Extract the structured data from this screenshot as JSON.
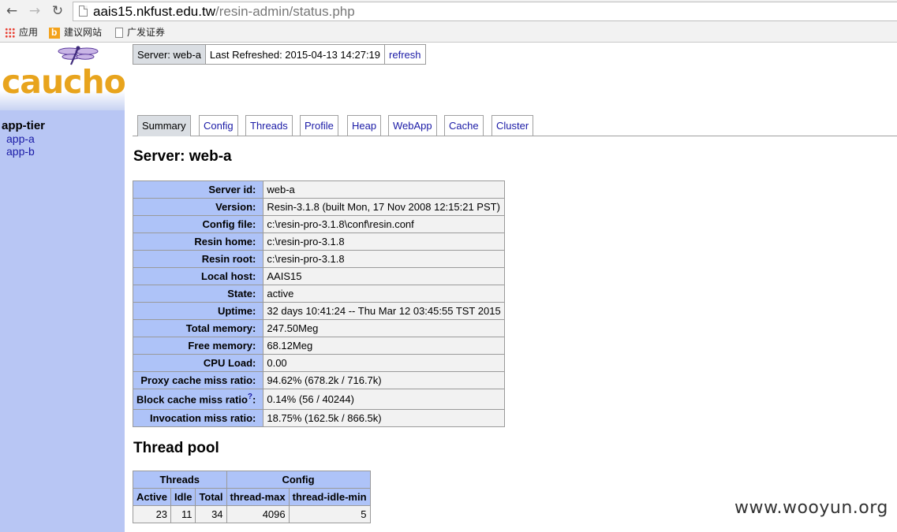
{
  "browser": {
    "url_host": "aais15.nkfust.edu.tw",
    "url_path": "/resin-admin/status.php",
    "bookmarks": [
      {
        "label": "应用",
        "icon": "apps-grid-icon"
      },
      {
        "label": "建议网站",
        "icon": "bing-icon"
      },
      {
        "label": "广发证券",
        "icon": "page-icon"
      }
    ]
  },
  "sidebar": {
    "logo": "caucho",
    "tier": "app-tier",
    "links": [
      "app-a",
      "app-b"
    ]
  },
  "header": {
    "server": "Server: web-a",
    "last_refreshed": "Last Refreshed: 2015-04-13 14:27:19",
    "refresh": "refresh"
  },
  "tabs": [
    "Summary",
    "Config",
    "Threads",
    "Profile",
    "Heap",
    "WebApp",
    "Cache",
    "Cluster"
  ],
  "active_tab": "Summary",
  "main": {
    "server_heading": "Server: web-a",
    "thread_heading": "Thread pool"
  },
  "summary": [
    {
      "label": "Server id:",
      "value": "web-a"
    },
    {
      "label": "Version:",
      "value": "Resin-3.1.8 (built Mon, 17 Nov 2008 12:15:21 PST)"
    },
    {
      "label": "Config file:",
      "value": "c:\\resin-pro-3.1.8\\conf\\resin.conf"
    },
    {
      "label": "Resin home:",
      "value": "c:\\resin-pro-3.1.8"
    },
    {
      "label": "Resin root:",
      "value": "c:\\resin-pro-3.1.8"
    },
    {
      "label": "Local host:",
      "value": "AAIS15"
    },
    {
      "label": "State:",
      "value": "active"
    },
    {
      "label": "Uptime:",
      "value": "32 days 10:41:24 -- Thu Mar 12 03:45:55 TST 2015"
    },
    {
      "label": "Total memory:",
      "value": "247.50Meg"
    },
    {
      "label": "Free memory:",
      "value": "68.12Meg"
    },
    {
      "label": "CPU Load:",
      "value": "0.00"
    },
    {
      "label": "Proxy cache miss ratio:",
      "value": "94.62% (678.2k / 716.7k)"
    },
    {
      "label": "Block cache miss ratio",
      "help": "?",
      "suffix": ":",
      "value": "0.14% (56 / 40244)"
    },
    {
      "label": "Invocation miss ratio:",
      "value": "18.75% (162.5k / 866.5k)"
    }
  ],
  "thread_pool": {
    "group_threads": "Threads",
    "group_config": "Config",
    "columns": [
      "Active",
      "Idle",
      "Total",
      "thread-max",
      "thread-idle-min"
    ],
    "values": [
      "23",
      "11",
      "34",
      "4096",
      "5"
    ]
  },
  "watermark": "www.wooyun.org"
}
